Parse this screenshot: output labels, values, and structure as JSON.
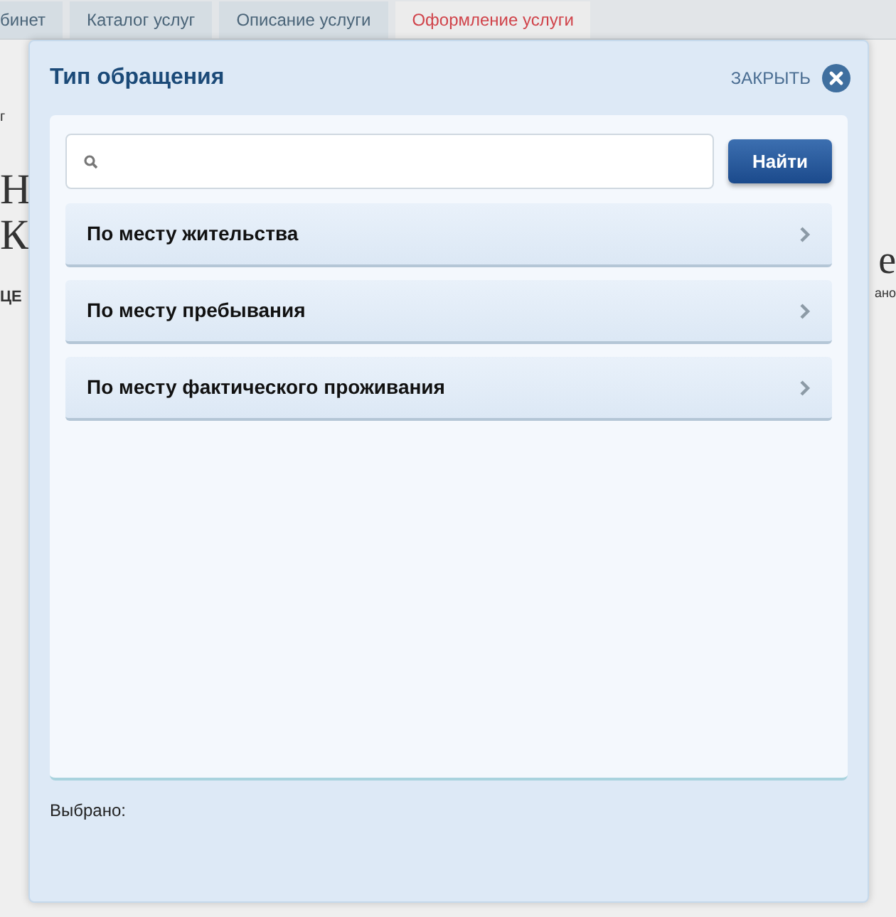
{
  "tabs": [
    {
      "label": "бинет",
      "selected": false
    },
    {
      "label": "Каталог услуг",
      "selected": false
    },
    {
      "label": "Описание услуги",
      "selected": false
    },
    {
      "label": "Оформление услуги",
      "selected": true
    }
  ],
  "background_fragments": {
    "left": [
      "г",
      "Н",
      "К",
      "ЦЕ"
    ],
    "right": [
      "е",
      "ано"
    ]
  },
  "dialog": {
    "title": "Тип обращения",
    "close_label": "ЗАКРЫТЬ",
    "search": {
      "button": "Найти"
    },
    "items": [
      {
        "label": "По месту жительства"
      },
      {
        "label": "По месту пребывания"
      },
      {
        "label": "По месту фактического проживания"
      }
    ],
    "selected_label": "Выбрано:"
  }
}
